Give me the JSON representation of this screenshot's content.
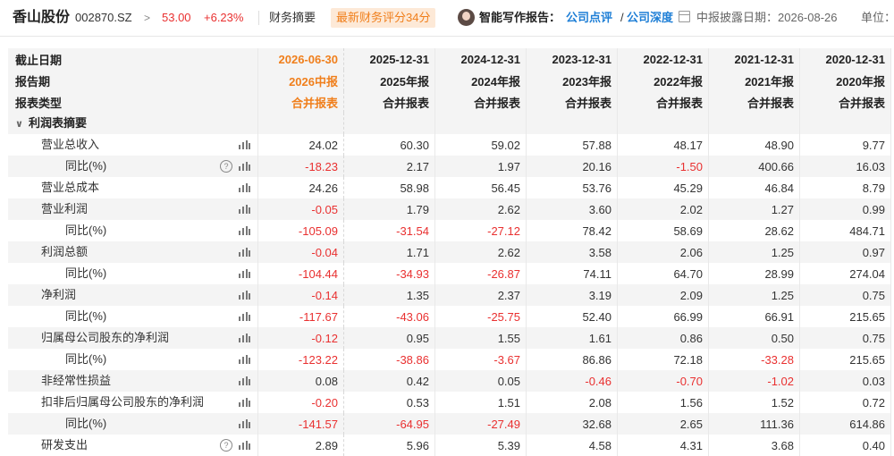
{
  "header": {
    "stock_name": "香山股份",
    "stock_code": "002870.SZ",
    "chevron": ">",
    "price": "53.00",
    "change_pct": "+6.23%",
    "tab_financial_summary": "财务摘要",
    "score_badge": "最新财务评分34分",
    "ai_report_label": "智能写作报告：",
    "link_company_review": "公司点评",
    "link_separator": "/",
    "link_company_depth": "公司深度",
    "report_date_label": "中报披露日期：2026-08-26",
    "unit_label": "单位："
  },
  "table": {
    "header_rows": [
      {
        "label": "截止日期",
        "values": [
          "2026-06-30",
          "2025-12-31",
          "2024-12-31",
          "2023-12-31",
          "2022-12-31",
          "2021-12-31",
          "2020-12-31"
        ]
      },
      {
        "label": "报告期",
        "values": [
          "2026中报",
          "2025年报",
          "2024年报",
          "2023年报",
          "2022年报",
          "2021年报",
          "2020年报"
        ]
      },
      {
        "label": "报表类型",
        "values": [
          "合并报表",
          "合并报表",
          "合并报表",
          "合并报表",
          "合并报表",
          "合并报表",
          "合并报表"
        ]
      }
    ],
    "section_label": "利润表摘要",
    "section_chevron": "∨",
    "help_glyph": "?",
    "rows": [
      {
        "label": "营业总收入",
        "level": 1,
        "help": false,
        "values": [
          "24.02",
          "60.30",
          "59.02",
          "57.88",
          "48.17",
          "48.90",
          "9.77"
        ]
      },
      {
        "label": "同比(%)",
        "level": 2,
        "help": true,
        "values": [
          "-18.23",
          "2.17",
          "1.97",
          "20.16",
          "-1.50",
          "400.66",
          "16.03"
        ]
      },
      {
        "label": "营业总成本",
        "level": 1,
        "help": false,
        "values": [
          "24.26",
          "58.98",
          "56.45",
          "53.76",
          "45.29",
          "46.84",
          "8.79"
        ]
      },
      {
        "label": "营业利润",
        "level": 1,
        "help": false,
        "values": [
          "-0.05",
          "1.79",
          "2.62",
          "3.60",
          "2.02",
          "1.27",
          "0.99"
        ]
      },
      {
        "label": "同比(%)",
        "level": 2,
        "help": false,
        "values": [
          "-105.09",
          "-31.54",
          "-27.12",
          "78.42",
          "58.69",
          "28.62",
          "484.71"
        ]
      },
      {
        "label": "利润总额",
        "level": 1,
        "help": false,
        "values": [
          "-0.04",
          "1.71",
          "2.62",
          "3.58",
          "2.06",
          "1.25",
          "0.97"
        ]
      },
      {
        "label": "同比(%)",
        "level": 2,
        "help": false,
        "values": [
          "-104.44",
          "-34.93",
          "-26.87",
          "74.11",
          "64.70",
          "28.99",
          "274.04"
        ]
      },
      {
        "label": "净利润",
        "level": 1,
        "help": false,
        "values": [
          "-0.14",
          "1.35",
          "2.37",
          "3.19",
          "2.09",
          "1.25",
          "0.75"
        ]
      },
      {
        "label": "同比(%)",
        "level": 2,
        "help": false,
        "values": [
          "-117.67",
          "-43.06",
          "-25.75",
          "52.40",
          "66.99",
          "66.91",
          "215.65"
        ]
      },
      {
        "label": "归属母公司股东的净利润",
        "level": 1,
        "help": false,
        "values": [
          "-0.12",
          "0.95",
          "1.55",
          "1.61",
          "0.86",
          "0.50",
          "0.75"
        ]
      },
      {
        "label": "同比(%)",
        "level": 2,
        "help": false,
        "values": [
          "-123.22",
          "-38.86",
          "-3.67",
          "86.86",
          "72.18",
          "-33.28",
          "215.65"
        ]
      },
      {
        "label": "非经常性损益",
        "level": 1,
        "help": false,
        "values": [
          "0.08",
          "0.42",
          "0.05",
          "-0.46",
          "-0.70",
          "-1.02",
          "0.03"
        ]
      },
      {
        "label": "扣非后归属母公司股东的净利润",
        "level": 1,
        "help": false,
        "values": [
          "-0.20",
          "0.53",
          "1.51",
          "2.08",
          "1.56",
          "1.52",
          "0.72"
        ]
      },
      {
        "label": "同比(%)",
        "level": 2,
        "help": false,
        "values": [
          "-141.57",
          "-64.95",
          "-27.49",
          "32.68",
          "2.65",
          "111.36",
          "614.86"
        ]
      },
      {
        "label": "研发支出",
        "level": 1,
        "help": true,
        "values": [
          "2.89",
          "5.96",
          "5.39",
          "4.58",
          "4.31",
          "3.68",
          "0.40"
        ]
      }
    ]
  },
  "colors": {
    "negative": "#e93030",
    "accent": "#f07f1c",
    "link": "#1f7fd6"
  },
  "icons": {
    "row_chart": "bar-chart-icon",
    "help": "help-icon",
    "calendar": "calendar-icon",
    "section": "chevron-down-icon"
  }
}
